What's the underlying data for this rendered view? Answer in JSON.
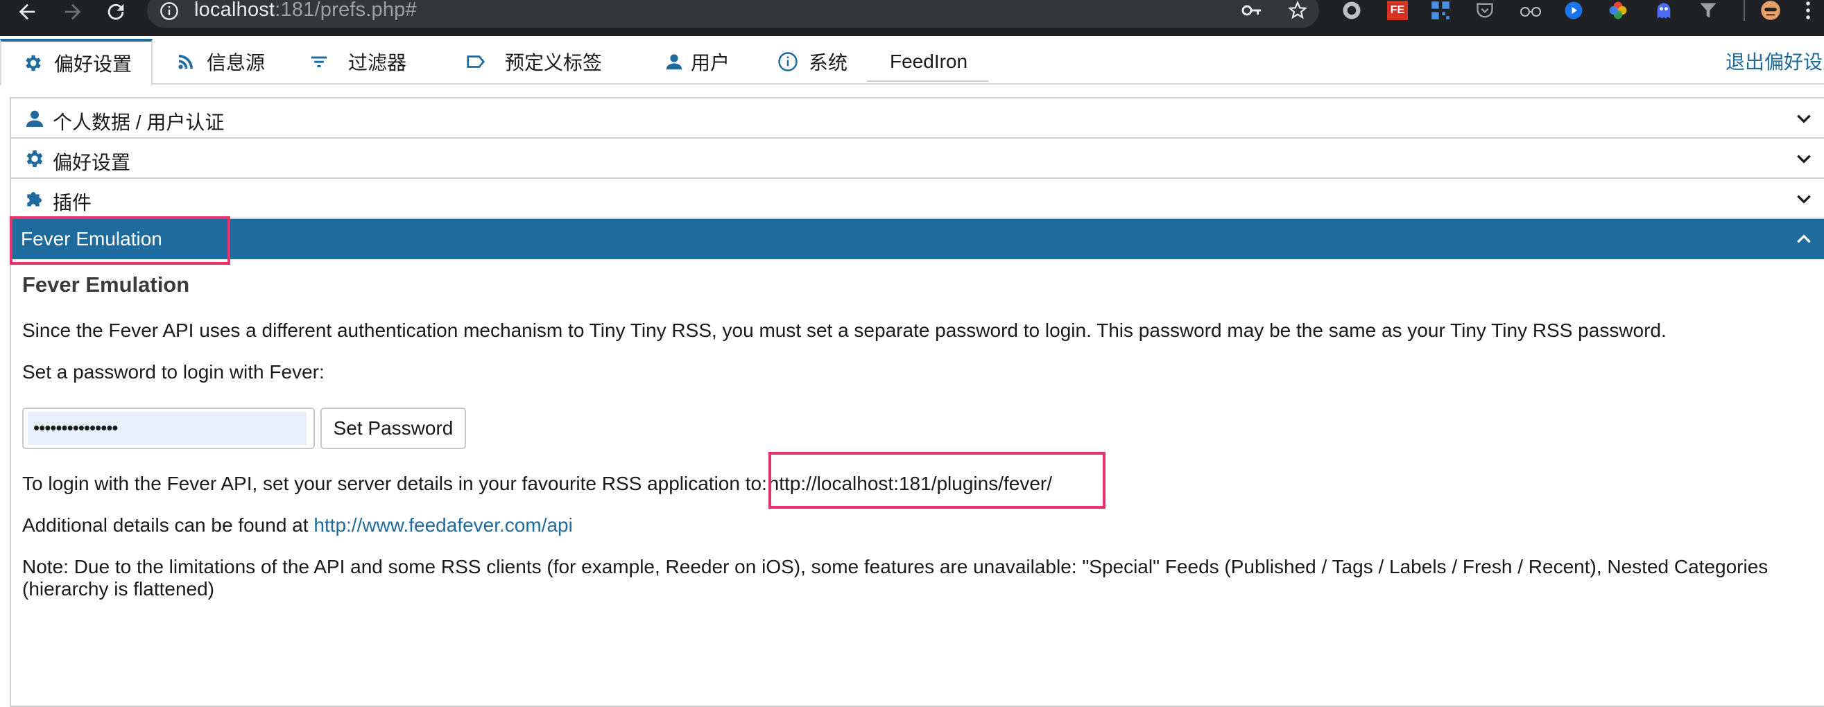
{
  "browser": {
    "url_host": "localhost",
    "url_rest": ":181/prefs.php#",
    "extensions": [
      "key-icon",
      "star-icon",
      "circle-ext-icon",
      "fe-ext-icon",
      "qr-ext-icon",
      "pocket-icon",
      "glasses-ext-icon",
      "play-ext-icon",
      "photos-ext-icon",
      "ghost-ext-icon",
      "funnel-ext-icon",
      "avatar-icon",
      "menu-dots-icon"
    ],
    "fe_label": "FE"
  },
  "tabs": [
    {
      "label": "偏好设置",
      "icon": "gear-icon"
    },
    {
      "label": "信息源",
      "icon": "rss-icon"
    },
    {
      "label": "过滤器",
      "icon": "filter-icon"
    },
    {
      "label": "预定义标签",
      "icon": "tag-icon"
    },
    {
      "label": "用户",
      "icon": "user-icon"
    },
    {
      "label": "系统",
      "icon": "info-icon"
    },
    {
      "label": "FeedIron",
      "icon": ""
    }
  ],
  "logout_label": "退出偏好设置",
  "accordion": [
    {
      "label": "个人数据 / 用户认证",
      "icon": "user-icon"
    },
    {
      "label": "偏好设置",
      "icon": "gear-icon"
    },
    {
      "label": "插件",
      "icon": "puzzle-icon"
    },
    {
      "label": "Fever Emulation",
      "icon": ""
    }
  ],
  "fever": {
    "title": "Fever Emulation",
    "intro": "Since the Fever API uses a different authentication mechanism to Tiny Tiny RSS, you must set a separate password to login. This password may be the same as your Tiny Tiny RSS password.",
    "set_prompt": "Set a password to login with Fever:",
    "password_value": "•••••••••••••••",
    "set_button": "Set Password",
    "login_text": "To login with the Fever API, set your server details in your favourite RSS application to: ",
    "server_url": "http://localhost:181/plugins/fever/",
    "details_text": "Additional details can be found at ",
    "details_link": "http://www.feedafever.com/api",
    "note_line1": "Note: Due to the limitations of the API and some RSS clients (for example, Reeder on iOS), some features are unavailable: \"Special\" Feeds (Published / Tags / Labels / Fresh / Recent), Nested Categories",
    "note_line2": "(hierarchy is flattened)"
  },
  "colors": {
    "accent": "#1f6b9e",
    "highlight": "#e8336d",
    "chrome": "#202124"
  }
}
